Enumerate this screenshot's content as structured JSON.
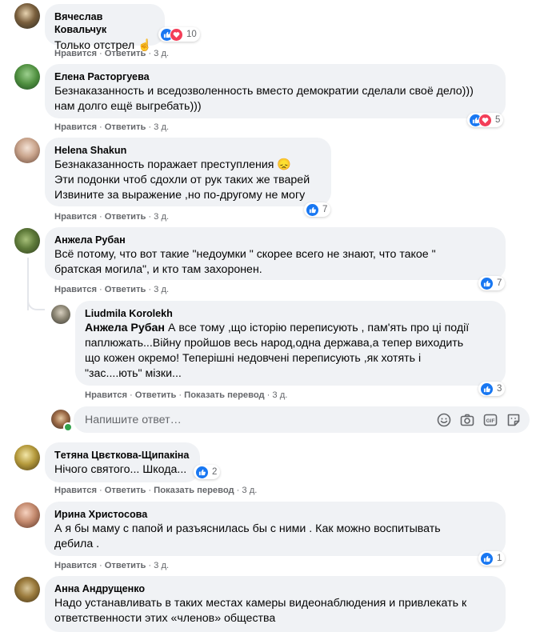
{
  "colors": {
    "bubble": "#f0f2f5",
    "meta": "#65676b",
    "like": "#1877f2",
    "love": "#f33e58"
  },
  "comments": [
    {
      "author": "Вячеслав Ковальчук",
      "text": "Только отстрел ☝",
      "reactions": "10",
      "actions": {
        "like": "Нравится",
        "reply": "Ответить",
        "time": "3 д."
      }
    },
    {
      "author": "Елена Расторгуева",
      "text": "Безнаказанность и вседозволенность вместо демократии сделали своё дело)))\nнам долго ещё выгребать)))",
      "reactions": "5",
      "actions": {
        "like": "Нравится",
        "reply": "Ответить",
        "time": "3 д."
      }
    },
    {
      "author": "Helena Shakun",
      "text": "Безнаказанность поражает преступления 😞\nЭти подонки чтоб сдохли от рук таких же тварей\nИзвините за выражение ,но по-другому не могу",
      "reactions": "7",
      "actions": {
        "like": "Нравится",
        "reply": "Ответить",
        "time": "3 д."
      }
    },
    {
      "author": "Анжела Рубан",
      "text": "Всё потому, что вот такие \"недоумки \" скорее всего не знают, что такое \"\nбратская могила\", и кто там захоронен.",
      "reactions": "7",
      "actions": {
        "like": "Нравится",
        "reply": "Ответить",
        "time": "3 д."
      }
    },
    {
      "author": "Tетяна Цвєткова-Щипакіна",
      "text": "Нічого святого... Шкода...",
      "reactions": "2",
      "actions": {
        "like": "Нравится",
        "reply": "Ответить",
        "translate": "Показать перевод",
        "time": "3 д."
      }
    },
    {
      "author": "Ирина Христосова",
      "text": "А я бы маму с папой и разъяснилась бы с ними . Как можно воспитывать\nдебила .",
      "reactions": "1",
      "actions": {
        "like": "Нравится",
        "reply": "Ответить",
        "time": "3 д."
      }
    },
    {
      "author": "Анна Андрущенко",
      "text": "Надо устанавливать в таких местах камеры видеонаблюдения и привлекать к\nответственности этих «членов» общества"
    }
  ],
  "reply": {
    "author": "Liudmila Korolekh",
    "mention": "Анжела Рубан",
    "text": " А все тому ,що історію переписують , пам'ять про ці події\nпаплюжать...Війну пройшов весь народ,одна держава,а тепер виходить\nщо кожен окремо! Теперішні недовчені переписують ,як хотять і\n\"зас....ють\" мізки...",
    "reactions": "3",
    "actions": {
      "like": "Нравится",
      "reply": "Ответить",
      "translate": "Показать перевод",
      "time": "3 д."
    }
  },
  "reply_input": {
    "placeholder": "Напишите ответ…"
  }
}
